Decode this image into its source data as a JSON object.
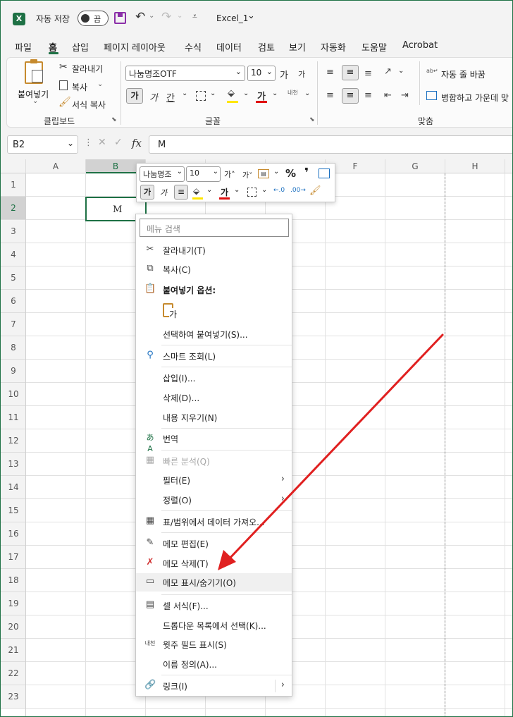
{
  "titlebar": {
    "autosave_label": "자동 저장",
    "toggle_state": "끔",
    "filename": "Excel_1",
    "filename_arrow": "⌄"
  },
  "tabs": [
    "파일",
    "홈",
    "삽입",
    "페이지 레이아웃",
    "수식",
    "데이터",
    "검토",
    "보기",
    "자동화",
    "도움말",
    "Acrobat"
  ],
  "ribbon": {
    "paste_label": "붙여넣기",
    "cut_label": "잘라내기",
    "copy_label": "복사",
    "format_painter_label": "서식 복사",
    "clipboard_group": "클립보드",
    "font_name": "나눔명조OTF",
    "font_size": "10",
    "font_group": "글꼴",
    "wrap_text_label": "자동 줄 바꿈",
    "merge_label": "병합하고 가운데 맞",
    "align_group": "맞춤",
    "bold_glyph": "가",
    "italic_glyph": "가",
    "underline_glyph": "간",
    "grow_glyph": "가",
    "shrink_glyph": "가",
    "font_color_glyph": "가",
    "phonetic_glyph": "내천"
  },
  "formula_bar": {
    "name_box": "B2",
    "fx": "fx",
    "value": "M"
  },
  "columns": [
    "A",
    "B",
    "C",
    "D",
    "E",
    "F",
    "G",
    "H"
  ],
  "rows": [
    "1",
    "2",
    "3",
    "4",
    "5",
    "6",
    "7",
    "8",
    "9",
    "10",
    "11",
    "12",
    "13",
    "14",
    "15",
    "16",
    "17",
    "18",
    "19",
    "20",
    "21",
    "22",
    "23"
  ],
  "cell_b2": "M",
  "mini_toolbar": {
    "font_name": "나눔명조",
    "font_size": "10",
    "percent": "%",
    "comma": "❜",
    "bold_glyph": "가",
    "italic_glyph": "가",
    "font_color_glyph": "가"
  },
  "context_menu": {
    "search_placeholder": "메뉴 검색",
    "items": [
      {
        "label": "잘라내기(T)"
      },
      {
        "label": "복사(C)"
      },
      {
        "label": "붙여넣기 옵션:"
      },
      {
        "label": "선택하여 붙여넣기(S)..."
      },
      {
        "label": "스마트 조회(L)"
      },
      {
        "label": "삽입(I)..."
      },
      {
        "label": "삭제(D)..."
      },
      {
        "label": "내용 지우기(N)"
      },
      {
        "label": "번역"
      },
      {
        "label": "빠른 분석(Q)"
      },
      {
        "label": "필터(E)"
      },
      {
        "label": "정렬(O)"
      },
      {
        "label": "표/범위에서 데이터 가져오..."
      },
      {
        "label": "메모 편집(E)"
      },
      {
        "label": "메모 삭제(T)"
      },
      {
        "label": "메모 표시/숨기기(O)"
      },
      {
        "label": "셀 서식(F)..."
      },
      {
        "label": "드롭다운 목록에서 선택(K)..."
      },
      {
        "label": "윗주 필드 표시(S)"
      },
      {
        "label": "이름 정의(A)..."
      },
      {
        "label": "링크(I)"
      }
    ],
    "paste_glyph": "가",
    "phonetic_glyph": "내천"
  },
  "colors": {
    "accent": "#1e7145",
    "arrow": "#e02020"
  }
}
